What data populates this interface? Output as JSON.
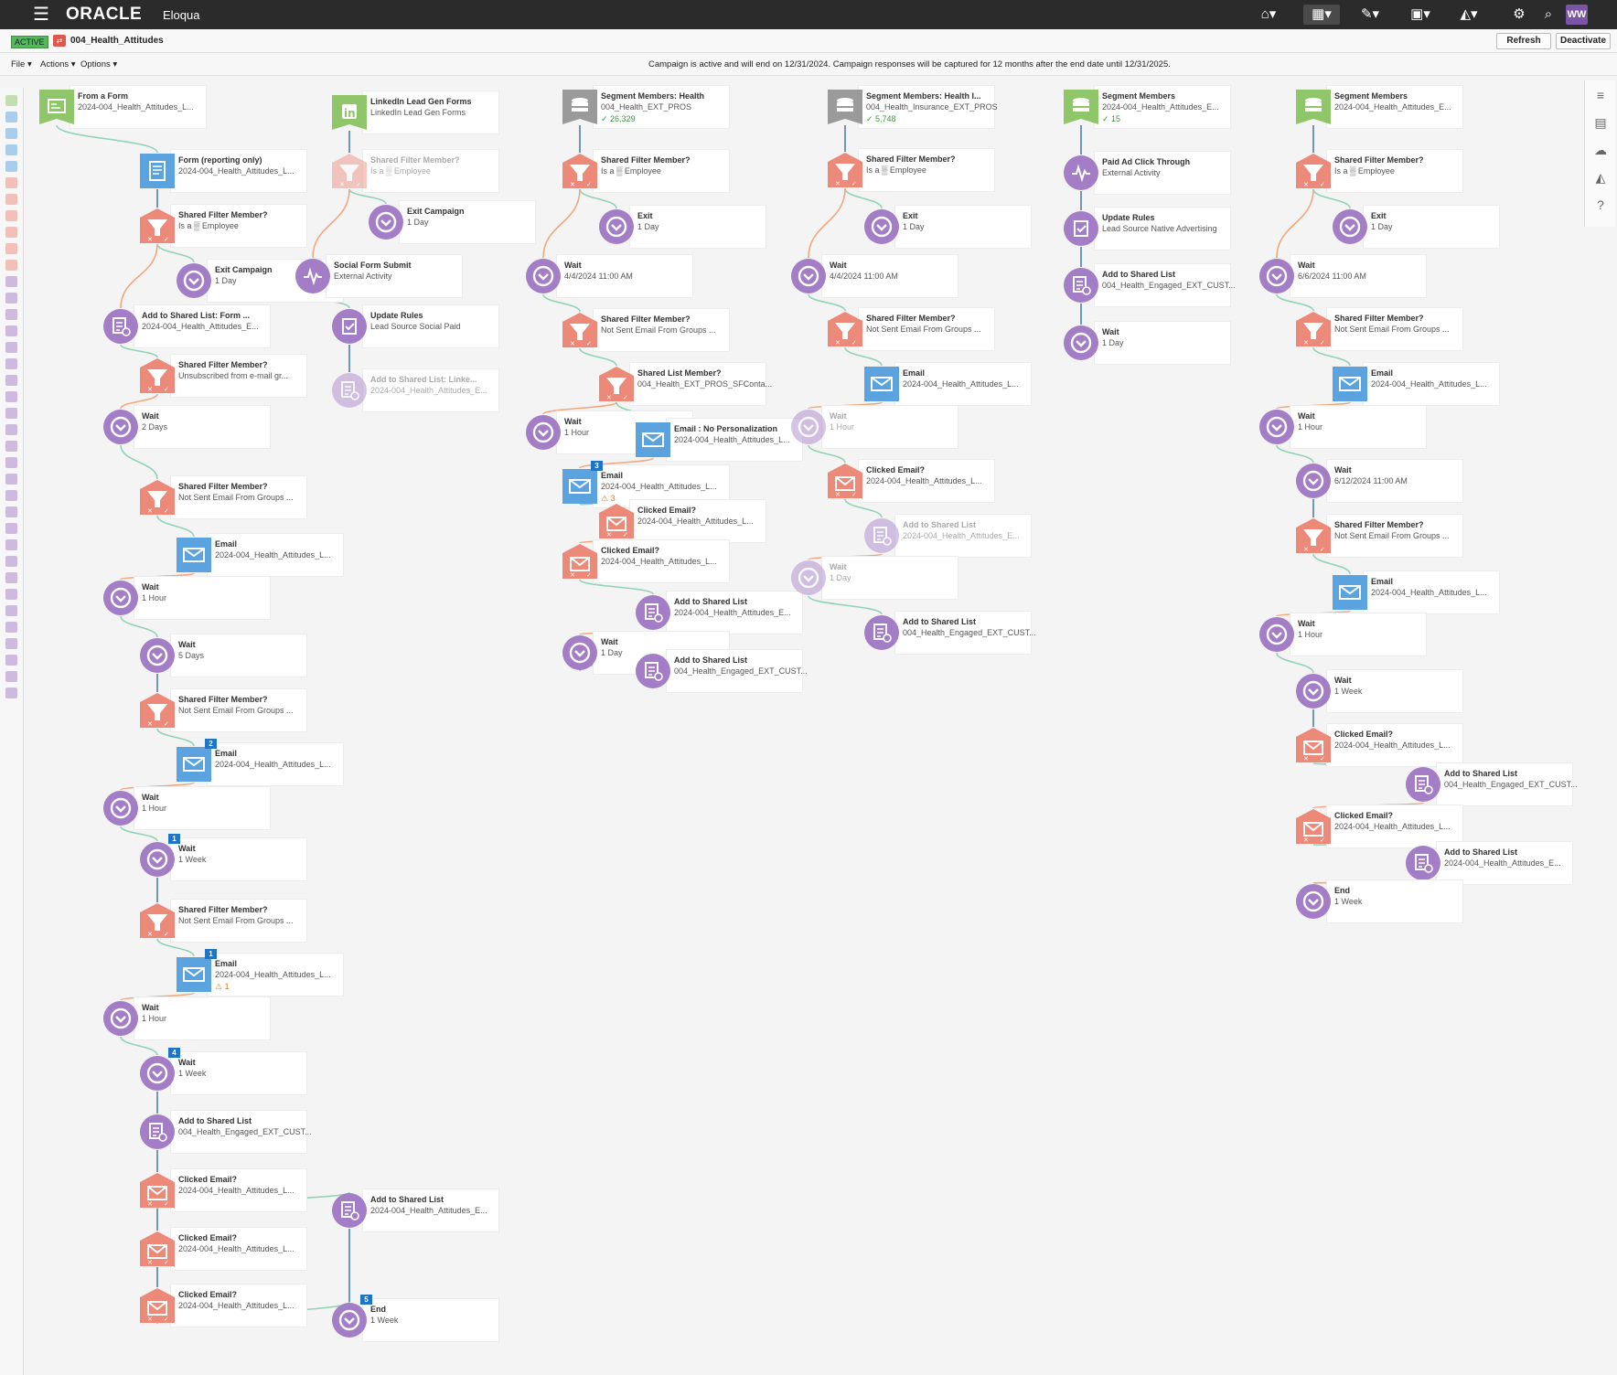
{
  "header": {
    "brand": "ORACLE",
    "product": "Eloqua",
    "user_initials": "WW"
  },
  "status": {
    "badge": "ACTIVE",
    "campaign_name": "004_Health_Attitudes",
    "refresh": "Refresh",
    "deactivate": "Deactivate"
  },
  "menu": {
    "file": "File ▾",
    "actions": "Actions ▾",
    "options": "Options ▾",
    "notice": "Campaign is active and will end on 12/31/2024. Campaign responses will be captured for 12 months after the end date until 12/31/2025."
  },
  "colors": {
    "segment": "#8fc66a",
    "filter": "#ec8979",
    "wait": "#a37ec7",
    "email": "#5ba3de",
    "list": "#a37ec7",
    "activity": "#a37ec7",
    "linkedin": "#8fc66a",
    "segmentGray": "#9a9a9a"
  },
  "steps": [
    {
      "type": "form-entry",
      "title": "From a Form",
      "sub": "2024-004_Health_Attitudes_L..."
    },
    {
      "type": "form",
      "title": "Form (reporting only)",
      "sub": "2024-004_Health_Attitudes_L..."
    },
    {
      "type": "filter",
      "title": "Shared Filter Member?",
      "sub": "Is a ▒ Employee"
    },
    {
      "type": "wait",
      "title": "Exit Campaign",
      "sub": "1 Day"
    },
    {
      "type": "list",
      "title": "Add to Shared List: Form ...",
      "sub": "2024-004_Health_Attitudes_E..."
    },
    {
      "type": "filter",
      "title": "Shared Filter Member?",
      "sub": "Unsubscribed from e-mail gr..."
    },
    {
      "type": "wait",
      "title": "Wait",
      "sub": "2 Days"
    },
    {
      "type": "filter",
      "title": "Shared Filter Member?",
      "sub": "Not Sent Email From Groups ..."
    },
    {
      "type": "email",
      "title": "Email",
      "sub": "2024-004_Health_Attitudes_L..."
    },
    {
      "type": "wait",
      "title": "Wait",
      "sub": "1 Hour"
    },
    {
      "type": "wait",
      "title": "Wait",
      "sub": "5 Days"
    },
    {
      "type": "filter",
      "title": "Shared Filter Member?",
      "sub": "Not Sent Email From Groups ..."
    },
    {
      "type": "email",
      "title": "Email",
      "sub": "2024-004_Health_Attitudes_L...",
      "count": "2"
    },
    {
      "type": "wait",
      "title": "Wait",
      "sub": "1 Hour"
    },
    {
      "type": "wait",
      "title": "Wait",
      "sub": "1 Week",
      "count": "1"
    },
    {
      "type": "filter",
      "title": "Shared Filter Member?",
      "sub": "Not Sent Email From Groups ..."
    },
    {
      "type": "email",
      "title": "Email",
      "sub": "2024-004_Health_Attitudes_L...",
      "count": "1",
      "warn": "1"
    },
    {
      "type": "wait",
      "title": "Wait",
      "sub": "1 Hour"
    },
    {
      "type": "wait",
      "title": "Wait",
      "sub": "1 Week",
      "count": "4"
    },
    {
      "type": "list",
      "title": "Add to Shared List",
      "sub": "004_Health_Engaged_EXT_CUST..."
    },
    {
      "type": "clicked",
      "title": "Clicked Email?",
      "sub": "2024-004_Health_Attitudes_L..."
    },
    {
      "type": "clicked",
      "title": "Clicked Email?",
      "sub": "2024-004_Health_Attitudes_L..."
    },
    {
      "type": "clicked",
      "title": "Clicked Email?",
      "sub": "2024-004_Health_Attitudes_L..."
    },
    {
      "type": "list",
      "title": "Add to Shared List",
      "sub": "2024-004_Health_Attitudes_E..."
    },
    {
      "type": "wait",
      "title": "End",
      "sub": "1 Week",
      "count": "5"
    },
    {
      "type": "linkedin",
      "title": "LinkedIn Lead Gen Forms",
      "sub": "LinkedIn Lead Gen Forms"
    },
    {
      "type": "filter",
      "title": "Shared Filter Member?",
      "sub": "Is a ▒ Employee",
      "faded": true
    },
    {
      "type": "wait",
      "title": "Exit Campaign",
      "sub": "1 Day"
    },
    {
      "type": "activity",
      "title": "Social Form Submit",
      "sub": "External Activity"
    },
    {
      "type": "update",
      "title": "Update Rules",
      "sub": "Lead Source Social Paid"
    },
    {
      "type": "list",
      "title": "Add to Shared List: Linke...",
      "sub": "2024-004_Health_Attitudes_E...",
      "faded": true
    },
    {
      "type": "segment-gray",
      "title": "Segment Members: Health",
      "sub": "004_Health_EXT_PROS",
      "extra": "✓ 26,329"
    },
    {
      "type": "filter",
      "title": "Shared Filter Member?",
      "sub": "Is a ▒ Employee"
    },
    {
      "type": "wait",
      "title": "Exit",
      "sub": "1 Day"
    },
    {
      "type": "wait",
      "title": "Wait",
      "sub": "4/4/2024 11:00 AM"
    },
    {
      "type": "filter",
      "title": "Shared Filter Member?",
      "sub": "Not Sent Email From Groups ..."
    },
    {
      "type": "filter",
      "title": "Shared List Member?",
      "sub": "004_Health_EXT_PROS_SFConta..."
    },
    {
      "type": "wait",
      "title": "Wait",
      "sub": "1 Hour"
    },
    {
      "type": "email",
      "title": "Email : No Personalization",
      "sub": "2024-004_Health_Attitudes_L..."
    },
    {
      "type": "email",
      "title": "Email",
      "sub": "2024-004_Health_Attitudes_L...",
      "count": "3",
      "warn": "3"
    },
    {
      "type": "clicked",
      "title": "Clicked Email?",
      "sub": "2024-004_Health_Attitudes_L..."
    },
    {
      "type": "clicked",
      "title": "Clicked Email?",
      "sub": "2024-004_Health_Attitudes_L..."
    },
    {
      "type": "list",
      "title": "Add to Shared List",
      "sub": "2024-004_Health_Attitudes_E..."
    },
    {
      "type": "wait",
      "title": "Wait",
      "sub": "1 Day"
    },
    {
      "type": "list",
      "title": "Add to Shared List",
      "sub": "004_Health_Engaged_EXT_CUST..."
    },
    {
      "type": "segment-gray",
      "title": "Segment Members: Health I...",
      "sub": "004_Health_Insurance_EXT_PROS",
      "extra": "✓ 5,748"
    },
    {
      "type": "filter",
      "title": "Shared Filter Member?",
      "sub": "Is a ▒ Employee"
    },
    {
      "type": "wait",
      "title": "Exit",
      "sub": "1 Day"
    },
    {
      "type": "wait",
      "title": "Wait",
      "sub": "4/4/2024 11:00 AM"
    },
    {
      "type": "filter",
      "title": "Shared Filter Member?",
      "sub": "Not Sent Email From Groups ..."
    },
    {
      "type": "email",
      "title": "Email",
      "sub": "2024-004_Health_Attitudes_L..."
    },
    {
      "type": "wait",
      "title": "Wait",
      "sub": "1 Hour",
      "faded": true
    },
    {
      "type": "clicked",
      "title": "Clicked Email?",
      "sub": "2024-004_Health_Attitudes_L..."
    },
    {
      "type": "list",
      "title": "Add to Shared List",
      "sub": "2024-004_Health_Attitudes_E...",
      "faded": true
    },
    {
      "type": "wait",
      "title": "Wait",
      "sub": "1 Day",
      "faded": true
    },
    {
      "type": "list",
      "title": "Add to Shared List",
      "sub": "004_Health_Engaged_EXT_CUST..."
    },
    {
      "type": "segment",
      "title": "Segment Members",
      "sub": "2024-004_Health_Attitudes_E...",
      "extra": "✓ 15"
    },
    {
      "type": "activity",
      "title": "Paid Ad Click Through",
      "sub": "External Activity"
    },
    {
      "type": "update",
      "title": "Update Rules",
      "sub": "Lead Source Native Advertising"
    },
    {
      "type": "list",
      "title": "Add to Shared List",
      "sub": "004_Health_Engaged_EXT_CUST..."
    },
    {
      "type": "wait",
      "title": "Wait",
      "sub": "1 Day"
    },
    {
      "type": "segment",
      "title": "Segment Members",
      "sub": "2024-004_Health_Attitudes_E..."
    },
    {
      "type": "filter",
      "title": "Shared Filter Member?",
      "sub": "Is a ▒ Employee"
    },
    {
      "type": "wait",
      "title": "Exit",
      "sub": "1 Day"
    },
    {
      "type": "wait",
      "title": "Wait",
      "sub": "6/6/2024 11:00 AM"
    },
    {
      "type": "filter",
      "title": "Shared Filter Member?",
      "sub": "Not Sent Email From Groups ..."
    },
    {
      "type": "email",
      "title": "Email",
      "sub": "2024-004_Health_Attitudes_L..."
    },
    {
      "type": "wait",
      "title": "Wait",
      "sub": "1 Hour"
    },
    {
      "type": "wait",
      "title": "Wait",
      "sub": "6/12/2024 11:00 AM"
    },
    {
      "type": "filter",
      "title": "Shared Filter Member?",
      "sub": "Not Sent Email From Groups ..."
    },
    {
      "type": "email",
      "title": "Email",
      "sub": "2024-004_Health_Attitudes_L..."
    },
    {
      "type": "wait",
      "title": "Wait",
      "sub": "1 Hour"
    },
    {
      "type": "wait",
      "title": "Wait",
      "sub": "1 Week"
    },
    {
      "type": "clicked",
      "title": "Clicked Email?",
      "sub": "2024-004_Health_Attitudes_L..."
    },
    {
      "type": "list",
      "title": "Add to Shared List",
      "sub": "004_Health_Engaged_EXT_CUST..."
    },
    {
      "type": "clicked",
      "title": "Clicked Email?",
      "sub": "2024-004_Health_Attitudes_L..."
    },
    {
      "type": "list",
      "title": "Add to Shared List",
      "sub": "2024-004_Health_Attitudes_E..."
    },
    {
      "type": "wait",
      "title": "End",
      "sub": "1 Week"
    }
  ]
}
